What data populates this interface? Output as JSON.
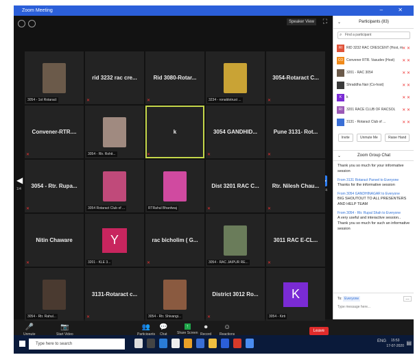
{
  "window": {
    "title": "Zoom Meeting",
    "controls": "–   ✕",
    "view_label": "Speaker View"
  },
  "tiles": [
    {
      "kind": "photo",
      "label": "3054 - 1st Rotaract",
      "color": "#6b5a4a"
    },
    {
      "kind": "text",
      "name": "rid 3232 rac cre..."
    },
    {
      "kind": "text",
      "name": "Rid 3080-Rotar..."
    },
    {
      "kind": "photo",
      "label": "3234 - ronaldotrust ...",
      "color": "#c9a335"
    },
    {
      "kind": "text",
      "name": "3054-Rotaract C..."
    },
    {
      "kind": "text",
      "name": "Convener-RTR...."
    },
    {
      "kind": "photo",
      "label": "3054 - Rtr. Rohit...",
      "color": "#a08a80"
    },
    {
      "kind": "text",
      "name": "k",
      "active": true
    },
    {
      "kind": "text",
      "name": "3054 GANDHID..."
    },
    {
      "kind": "text",
      "name": "Pune 3131- Rot..."
    },
    {
      "kind": "text",
      "name": "3054 - Rtr. Rupa..."
    },
    {
      "kind": "photo",
      "label": "3054 Rotaract Club of ...",
      "color": "#c04a7a"
    },
    {
      "kind": "photo",
      "label": "RTRahul Bhardwaj",
      "color": "#d04aa0"
    },
    {
      "kind": "text",
      "name": "Dist 3201 RAC C..."
    },
    {
      "kind": "text",
      "name": "Rtr. Nilesh Chau..."
    },
    {
      "kind": "text",
      "name": "Nitin Chaware"
    },
    {
      "kind": "avatar",
      "letter": "Y",
      "label": "3201 - KLE 3..."
    },
    {
      "kind": "text",
      "name": "rac bicholim ( G..."
    },
    {
      "kind": "photo",
      "label": "3054 - RAC JAIPUR RE...",
      "color": "#6a7c5a"
    },
    {
      "kind": "text",
      "name": "3011 RAC E-CL..."
    },
    {
      "kind": "photo",
      "label": "3054 - Rtr. Rahul...",
      "color": "#4a3a30"
    },
    {
      "kind": "text",
      "name": "3131-Rotaract c..."
    },
    {
      "kind": "photo",
      "label": "3054 - Rtr. Shivangi...",
      "color": "#8a5a40"
    },
    {
      "kind": "text",
      "name": "District 3012 Ro..."
    },
    {
      "kind": "avatar",
      "letter": "K",
      "label": "3054 - Kirti"
    }
  ],
  "pages": {
    "left": "1/4",
    "right": "1/4"
  },
  "toolbar": {
    "items": [
      {
        "icon": "mic-icon",
        "glyph": "🎤",
        "label": "Unmute"
      },
      {
        "icon": "video-icon",
        "glyph": "📷",
        "label": "Start Video"
      },
      {
        "icon": "participants-icon",
        "glyph": "👥",
        "label": "Participants"
      },
      {
        "icon": "chat-icon",
        "glyph": "💬",
        "label": "Chat"
      },
      {
        "icon": "share-icon",
        "glyph": "↑",
        "label": "Share Screen"
      },
      {
        "icon": "record-icon",
        "glyph": "⏺",
        "label": "Record"
      },
      {
        "icon": "reactions-icon",
        "glyph": "☺",
        "label": "Reactions"
      }
    ],
    "leave_label": "Leave"
  },
  "participants": {
    "header": "Participants (83)",
    "search_placeholder": "Find a participant",
    "rows": [
      {
        "initials": "RI",
        "color": "#e0533a",
        "name": "RID 3232 RAC CRESCENT (Host, me)"
      },
      {
        "initials": "CO",
        "color": "#f08a1a",
        "name": "Convener RTR. Vasudev (Host)"
      },
      {
        "initials": "",
        "color": "#6b5a4a",
        "name": "3201 - RAC 3054"
      },
      {
        "initials": "",
        "color": "#3a3a3a",
        "name": "Shraddha Nair (Co-host)"
      },
      {
        "initials": "K",
        "color": "#7a2bd4",
        "name": "k"
      },
      {
        "initials": "RI",
        "color": "#9b59b6",
        "name": "3201 RACE CLUB OF RACSOL"
      },
      {
        "initials": "",
        "color": "#3a6fd6",
        "name": "3131 - Rotaract Club of ..."
      }
    ],
    "buttons": [
      "Invite",
      "Unmute Me",
      "Raise Hand"
    ]
  },
  "chat": {
    "header": "Zoom Group Chat",
    "messages": [
      {
        "from": "",
        "text": "Thank you so much for your informative session"
      },
      {
        "from": "From 3131 Rotaract Panvel to Everyone",
        "text": "Thanks for the informative session"
      },
      {
        "from": "From 3054 GANDHINAGAR to Everyone",
        "text": "BIG SHOUTOUT TO ALL PRESENTERS AND HELP TEAM"
      },
      {
        "from": "From 3054 - Rtr. Rupal Shah to Everyone",
        "text": "A very useful and interactive session.. Thank you so much for such an informative session"
      }
    ],
    "to_label": "To:",
    "to_value": "Everyone",
    "input_placeholder": "Type message here..."
  },
  "taskbar": {
    "search_placeholder": "Type here to search",
    "tray": "ENG",
    "time": "15:53",
    "date": "17-07-2020"
  }
}
